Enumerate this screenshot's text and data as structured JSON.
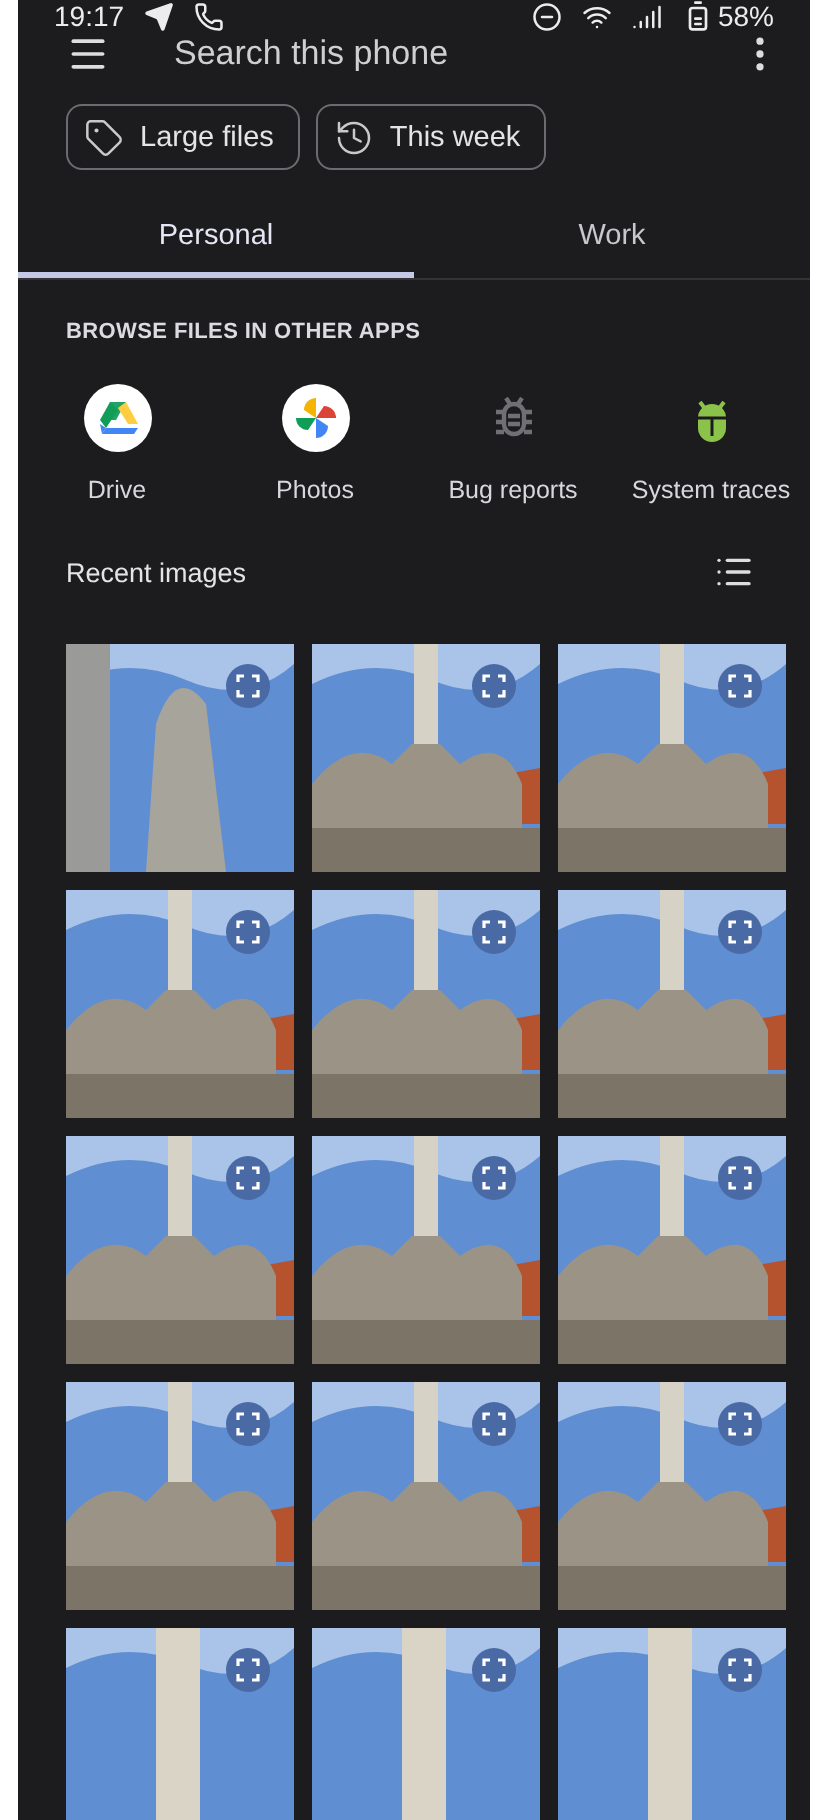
{
  "status_bar": {
    "time": "19:17",
    "battery": "58%"
  },
  "search": {
    "placeholder": "Search this phone"
  },
  "chips": [
    {
      "label": "Large files",
      "kind": "tag"
    },
    {
      "label": "This week",
      "kind": "history"
    }
  ],
  "tabs": [
    {
      "label": "Personal",
      "selected": true
    },
    {
      "label": "Work",
      "selected": false
    }
  ],
  "browse": {
    "title": "BROWSE FILES IN OTHER APPS",
    "apps": [
      {
        "label": "Drive",
        "kind": "drive"
      },
      {
        "label": "Photos",
        "kind": "photos"
      },
      {
        "label": "Bug reports",
        "kind": "bug"
      },
      {
        "label": "System traces",
        "kind": "traces"
      }
    ]
  },
  "recent_images": {
    "title": "Recent images",
    "images": [
      {
        "kind": "statue-close"
      },
      {
        "kind": "column"
      },
      {
        "kind": "column"
      },
      {
        "kind": "column"
      },
      {
        "kind": "column"
      },
      {
        "kind": "column"
      },
      {
        "kind": "column"
      },
      {
        "kind": "column"
      },
      {
        "kind": "column"
      },
      {
        "kind": "column"
      },
      {
        "kind": "column"
      },
      {
        "kind": "column"
      },
      {
        "kind": "column-top"
      },
      {
        "kind": "column-top"
      },
      {
        "kind": "column-top"
      }
    ]
  }
}
